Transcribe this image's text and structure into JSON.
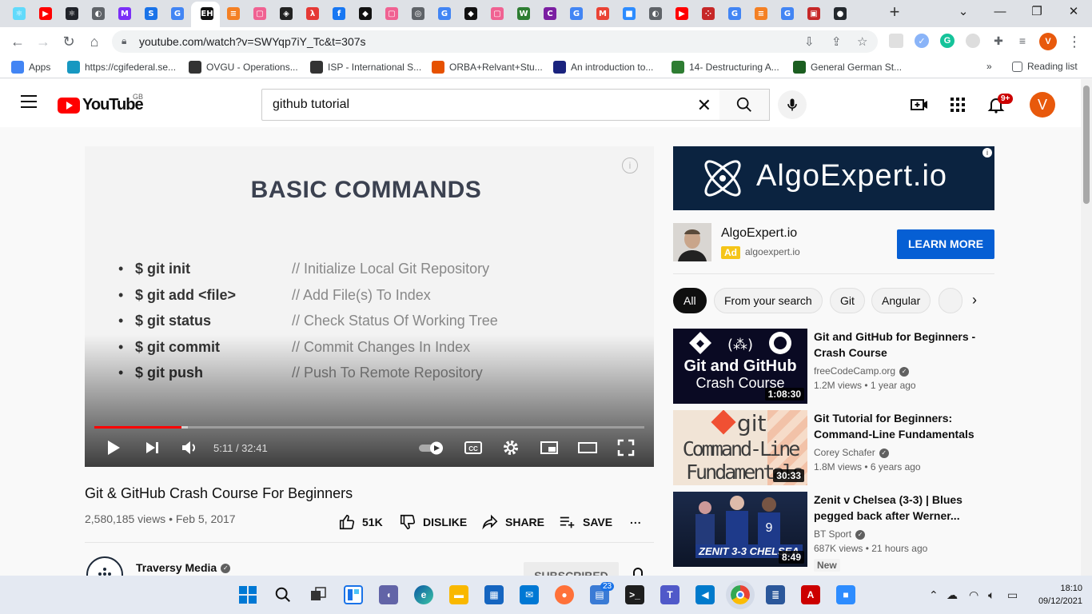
{
  "browser": {
    "tabs": [
      {
        "icon": "react-icon",
        "color": "#61dafb",
        "glyph": "⚛"
      },
      {
        "icon": "youtube-icon",
        "color": "#ff0000",
        "glyph": "▶"
      },
      {
        "icon": "react-icon",
        "color": "#20232a",
        "glyph": "⚛"
      },
      {
        "icon": "globe-icon",
        "color": "#5f6368",
        "glyph": "◐"
      },
      {
        "icon": "m-logo-icon",
        "color": "#7b2ff7",
        "glyph": "M"
      },
      {
        "icon": "s-logo-icon",
        "color": "#1a73e8",
        "glyph": "S"
      },
      {
        "icon": "google-icon",
        "color": "#4285f4",
        "glyph": "G"
      },
      {
        "icon": "eh-logo-icon",
        "color": "#111111",
        "glyph": "EH"
      },
      {
        "icon": "stackoverflow-icon",
        "color": "#f48024",
        "glyph": "≡"
      },
      {
        "icon": "pink-square-icon",
        "color": "#f06292",
        "glyph": "▢"
      },
      {
        "icon": "codesandbox-icon",
        "color": "#222222",
        "glyph": "◈"
      },
      {
        "icon": "red-figure-icon",
        "color": "#e53935",
        "glyph": "λ"
      },
      {
        "icon": "facebook-icon",
        "color": "#1877f2",
        "glyph": "f"
      },
      {
        "icon": "notion-icon",
        "color": "#111111",
        "glyph": "◆"
      },
      {
        "icon": "pink-square-icon",
        "color": "#f06292",
        "glyph": "▢"
      },
      {
        "icon": "chrome-icon",
        "color": "#5f6368",
        "glyph": "◎"
      },
      {
        "icon": "google-icon",
        "color": "#4285f4",
        "glyph": "G"
      },
      {
        "icon": "notion-icon",
        "color": "#111111",
        "glyph": "◆"
      },
      {
        "icon": "pink-square-icon",
        "color": "#f06292",
        "glyph": "▢"
      },
      {
        "icon": "w-logo-icon",
        "color": "#2e7d32",
        "glyph": "W"
      },
      {
        "icon": "c-logo-icon",
        "color": "#7b1fa2",
        "glyph": "C"
      },
      {
        "icon": "google-icon",
        "color": "#4285f4",
        "glyph": "G"
      },
      {
        "icon": "gmail-icon",
        "color": "#ea4335",
        "glyph": "M"
      },
      {
        "icon": "zoom-icon",
        "color": "#2d8cff",
        "glyph": "■"
      },
      {
        "icon": "globe-icon",
        "color": "#5f6368",
        "glyph": "◐"
      },
      {
        "icon": "youtube-icon",
        "color": "#ff0000",
        "glyph": "▶"
      },
      {
        "icon": "dots-icon",
        "color": "#c62828",
        "glyph": "⁘"
      },
      {
        "icon": "google-icon",
        "color": "#4285f4",
        "glyph": "G"
      },
      {
        "icon": "stackoverflow-icon",
        "color": "#f48024",
        "glyph": "≡"
      },
      {
        "icon": "google-icon",
        "color": "#4285f4",
        "glyph": "G"
      },
      {
        "icon": "red-box-icon",
        "color": "#c62828",
        "glyph": "▣"
      },
      {
        "icon": "github-icon",
        "color": "#24292e",
        "glyph": "●"
      }
    ],
    "active_tab_close": "✕",
    "new_tab": "+",
    "url": "youtube.com/watch?v=SWYqp7iY_Tc&t=307s",
    "profile_initial": "V",
    "bookmarks": [
      {
        "label": "Apps",
        "icon": "apps-grid-icon",
        "color": "#4285f4"
      },
      {
        "label": "https://cgifederal.se...",
        "icon": "salesforce-cloud-icon",
        "color": "#1798c1"
      },
      {
        "label": "OVGU - Operations...",
        "icon": "ovgu-icon",
        "color": "#333333"
      },
      {
        "label": "ISP - International S...",
        "icon": "isp-icon",
        "color": "#333333"
      },
      {
        "label": "ORBA+Relvant+Stu...",
        "icon": "orba-icon",
        "color": "#e65100"
      },
      {
        "label": "An introduction to...",
        "icon": "intro-icon",
        "color": "#1a237e"
      },
      {
        "label": "14- Destructuring A...",
        "icon": "t-logo-icon",
        "color": "#2e7d32"
      },
      {
        "label": "General German St...",
        "icon": "german-icon",
        "color": "#1b5e20"
      }
    ],
    "reading_list": "Reading list",
    "bookmarks_more": "»"
  },
  "youtube": {
    "logo_text": "YouTube",
    "country": "GB",
    "search_query": "github tutorial",
    "notifications_badge": "9+",
    "avatar_initial": "V"
  },
  "player": {
    "slide_title": "BASIC COMMANDS",
    "commands": [
      {
        "bullet": "•",
        "cmd": "$ git init",
        "comment": "// Initialize Local Git Repository"
      },
      {
        "bullet": "•",
        "cmd": "$ git add <file>",
        "comment": "// Add File(s) To Index"
      },
      {
        "bullet": "•",
        "cmd": "$ git status",
        "comment": "// Check Status Of Working Tree"
      },
      {
        "bullet": "•",
        "cmd": "$ git commit",
        "comment": "// Commit Changes In Index"
      },
      {
        "bullet": "•",
        "cmd": "$ git push",
        "comment": "// Push To Remote Repository"
      }
    ],
    "timecode": "5:11 / 32:41",
    "progress_played_fraction": 0.159,
    "progress_buffered_fraction": 0.17
  },
  "video": {
    "title": "Git & GitHub Crash Course For Beginners",
    "meta": "2,580,185 views • Feb 5, 2017",
    "likes": "51K",
    "dislike_label": "DISLIKE",
    "share_label": "SHARE",
    "save_label": "SAVE",
    "more": "...",
    "channel_name": "Traversy Media",
    "subscribe_label": "SUBSCRIBED"
  },
  "sidebar": {
    "ad_banner_text": "AlgoExpert.io",
    "ad_info": "i",
    "ad_name": "AlgoExpert.io",
    "ad_badge": "Ad",
    "ad_url": "algoexpert.io",
    "ad_cta": "LEARN MORE",
    "chips": [
      "All",
      "From your search",
      "Git",
      "Angular",
      ""
    ],
    "recommendations": [
      {
        "title": "Git and GitHub for Beginners - Crash Course",
        "channel": "freeCodeCamp.org",
        "verified": true,
        "views": "1.2M views • 1 year ago",
        "duration": "1:08:30",
        "thumb_line1": "Git and GitHub",
        "thumb_line2": "Crash Course",
        "new": ""
      },
      {
        "title": "Git Tutorial for Beginners: Command-Line Fundamentals",
        "channel": "Corey Schafer",
        "verified": true,
        "views": "1.8M views • 6 years ago",
        "duration": "30:33",
        "thumb_line1": "git",
        "thumb_line2": "Command-Line",
        "thumb_line3": "Fundamentals",
        "new": ""
      },
      {
        "title": "Zenit v Chelsea (3-3) | Blues pegged back after Werner...",
        "channel": "BT Sport",
        "verified": true,
        "views": "687K views • 21 hours ago",
        "duration": "8:49",
        "thumb_line1": "ZENIT 3-3 CHELSEA",
        "new": "New"
      }
    ]
  },
  "taskbar": {
    "badge": "23",
    "time": "18:10",
    "date": "09/12/2021"
  }
}
